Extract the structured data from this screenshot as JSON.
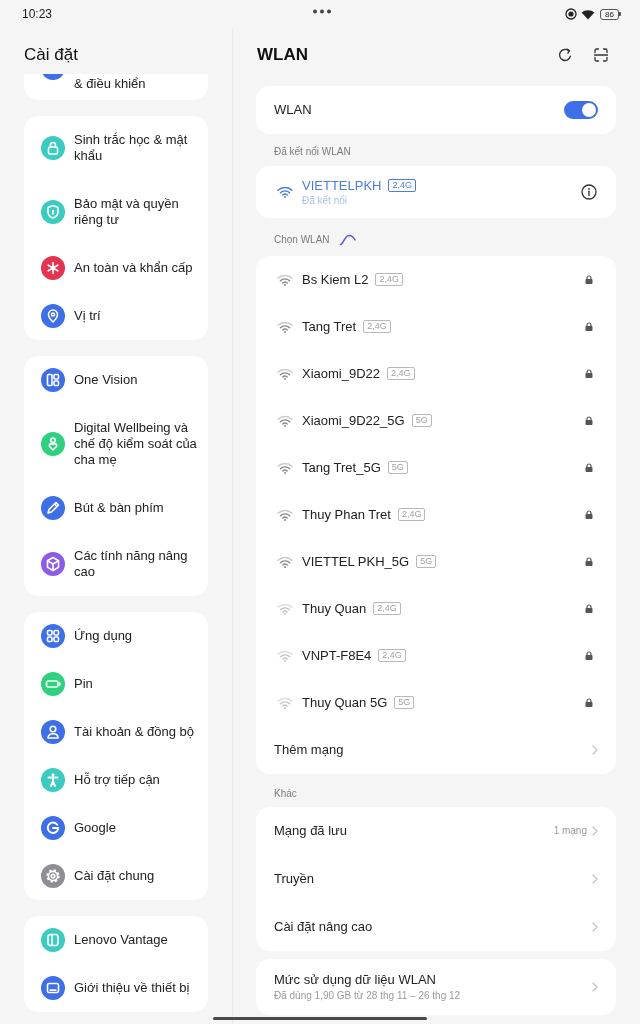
{
  "status_bar": {
    "time": "10:23",
    "battery": "86"
  },
  "sidebar": {
    "title": "Cài đặt",
    "groups": [
      {
        "partial": true,
        "items": [
          {
            "label": "& điều khiển",
            "color": "#3f6fe6"
          }
        ]
      },
      {
        "partial": false,
        "items": [
          {
            "label": "Sinh trắc học & mật khẩu",
            "color": "#3ccbc0"
          },
          {
            "label": "Bảo mật và quyền riêng tư",
            "color": "#3ccbc0"
          },
          {
            "label": "An toàn và khẩn cấp",
            "color": "#e2354f"
          },
          {
            "label": "Vị trí",
            "color": "#3f6fe6"
          }
        ]
      },
      {
        "partial": false,
        "items": [
          {
            "label": "One Vision",
            "color": "#3f6fe6"
          },
          {
            "label": "Digital Wellbeing và chế độ kiểm soát của cha mẹ",
            "color": "#2fd07f"
          },
          {
            "label": "Bút & bàn phím",
            "color": "#3f6fe6"
          },
          {
            "label": "Các tính năng nâng cao",
            "color": "#8c5ce6"
          }
        ]
      },
      {
        "partial": false,
        "items": [
          {
            "label": "Ứng dụng",
            "color": "#3f6fe6"
          },
          {
            "label": "Pin",
            "color": "#2fd07f"
          },
          {
            "label": "Tài khoản & đồng bộ",
            "color": "#3f6fe6"
          },
          {
            "label": "Hỗ trợ tiếp cận",
            "color": "#3ccbc0"
          },
          {
            "label": "Google",
            "color": "#3f6fe6"
          },
          {
            "label": "Cài đặt chung",
            "color": "#8e8e96"
          }
        ]
      },
      {
        "partial": false,
        "items": [
          {
            "label": "Lenovo Vantage",
            "color": "#3ccbc0"
          },
          {
            "label": "Giới thiệu về thiết bị",
            "color": "#3f6fe6"
          }
        ]
      }
    ]
  },
  "wlan": {
    "title": "WLAN",
    "toggle": {
      "label": "WLAN",
      "on": true
    },
    "connected": {
      "header": "Đã kết nối WLAN",
      "network": {
        "name": "VIETTELPKH",
        "band": "2,4G",
        "status": "Đã kết nối"
      }
    },
    "available": {
      "header": "Chọn WLAN",
      "scanning": true,
      "networks": [
        {
          "name": "Bs Kiem L2",
          "band": "2,4G",
          "weak_signal": false,
          "locked": true
        },
        {
          "name": "Tang Tret",
          "band": "2,4G",
          "weak_signal": false,
          "locked": true
        },
        {
          "name": "Xiaomi_9D22",
          "band": "2,4G",
          "weak_signal": false,
          "locked": true
        },
        {
          "name": "Xiaomi_9D22_5G",
          "band": "5G",
          "weak_signal": false,
          "locked": true
        },
        {
          "name": "Tang Tret_5G",
          "band": "5G",
          "weak_signal": false,
          "locked": true
        },
        {
          "name": "Thuy Phan Tret",
          "band": "2,4G",
          "weak_signal": false,
          "locked": true
        },
        {
          "name": "VIETTEL PKH_5G",
          "band": "5G",
          "weak_signal": false,
          "locked": true
        },
        {
          "name": "Thuy Quan",
          "band": "2,4G",
          "weak_signal": true,
          "locked": true
        },
        {
          "name": "VNPT-F8E4",
          "band": "2,4G",
          "weak_signal": true,
          "locked": true
        },
        {
          "name": "Thuy Quan 5G",
          "band": "5G",
          "weak_signal": true,
          "locked": true
        }
      ],
      "add_network": "Thêm mạng"
    },
    "other": {
      "header": "Khác",
      "items": [
        {
          "label": "Mạng đã lưu",
          "value": "1 mạng"
        },
        {
          "label": "Truyền"
        },
        {
          "label": "Cài đặt nâng cao"
        }
      ]
    },
    "data_usage": {
      "title": "Mức sử dụng dữ liệu WLAN",
      "subtitle": "Đã dùng 1,90 GB từ 28 thg 11 – 26 thg 12"
    }
  }
}
